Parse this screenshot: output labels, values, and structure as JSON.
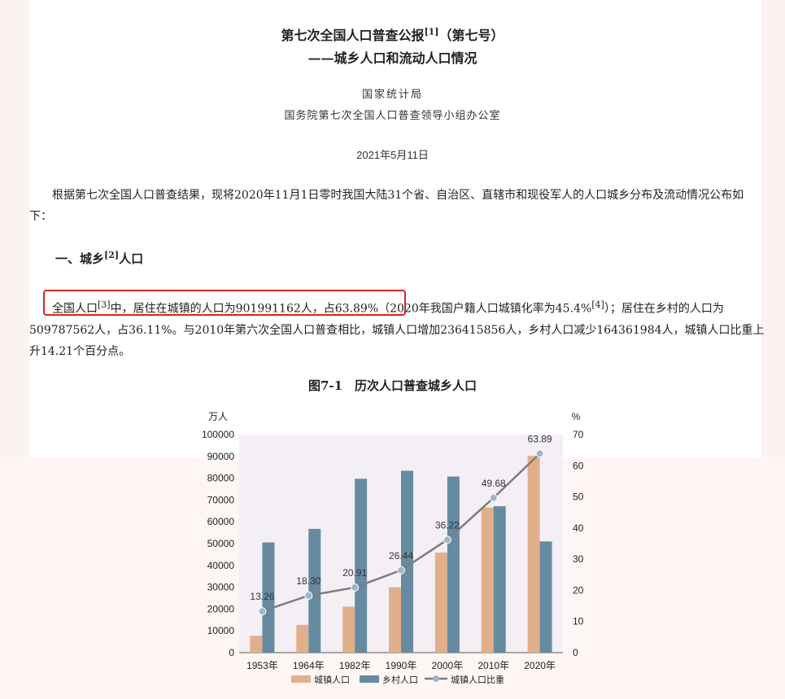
{
  "header": {
    "title_main": "第七次全国人口普查公报",
    "title_note": "[1]",
    "title_suffix": "（第七号）",
    "subtitle": "——城乡人口和流动人口情况",
    "issuer1": "国家统计局",
    "issuer2": "国务院第七次全国人口普查领导小组办公室",
    "date": "2021年5月11日"
  },
  "intro": "根据第七次全国人口普查结果，现将2020年11月1日零时我国大陆31个省、自治区、直辖市和现役军人的人口城乡分布及流动情况公布如下：",
  "section": {
    "title_a": "一、城乡",
    "note": "[2]",
    "title_b": "人口"
  },
  "body": {
    "part1": "全国人口",
    "note3": "[3]",
    "part2": "中，居住在城镇的人口为901991162人，占63.89%（2020年我国户籍人口城镇化率为45.4%",
    "note4": "[4]",
    "part3": "）；居住在乡村的人口为509787562人，占36.11%。与2010年第六次全国人口普查相比，城镇人口增加236415856人，乡村人口减少164361984人，城镇人口比重上升14.21个百分点。"
  },
  "chart_title": "图7-1　历次人口普查城乡人口",
  "colors": {
    "urban": "#e2af8b",
    "rural": "#668ba1",
    "ratio_line": "#7d7d7d",
    "ratio_marker": "#9fb6cc",
    "plot_bg": "#f3eff5",
    "highlight": "#d9241c"
  },
  "chart_data": {
    "type": "bar",
    "categories": [
      "1953年",
      "1964年",
      "1982年",
      "1990年",
      "2000年",
      "2010年",
      "2020年"
    ],
    "series": [
      {
        "name": "城镇人口",
        "values": [
          7726,
          12710,
          21082,
          29971,
          45844,
          66557,
          90199
        ]
      },
      {
        "name": "乡村人口",
        "values": [
          50534,
          56748,
          79736,
          83397,
          80739,
          67113,
          50979
        ]
      },
      {
        "name": "城镇人口比重",
        "type": "line",
        "axis": "right",
        "values": [
          13.26,
          18.3,
          20.91,
          26.44,
          36.22,
          49.68,
          63.89
        ]
      }
    ],
    "ylabel_left": "万人",
    "ylabel_right": "%",
    "ylim_left": [
      0,
      100000
    ],
    "ylim_right": [
      0,
      70
    ],
    "yticks_left": [
      "0",
      "10000",
      "20000",
      "30000",
      "40000",
      "50000",
      "60000",
      "70000",
      "80000",
      "90000",
      "100000"
    ],
    "yticks_right": [
      "0",
      "10",
      "20",
      "30",
      "40",
      "50",
      "60",
      "70"
    ],
    "data_labels": [
      "13.26",
      "18.30",
      "20.91",
      "26.44",
      "36.22",
      "49.68",
      "63.89"
    ],
    "legend": [
      "城镇人口",
      "乡村人口",
      "城镇人口比重"
    ],
    "legend_position": "bottom",
    "grid": false
  }
}
